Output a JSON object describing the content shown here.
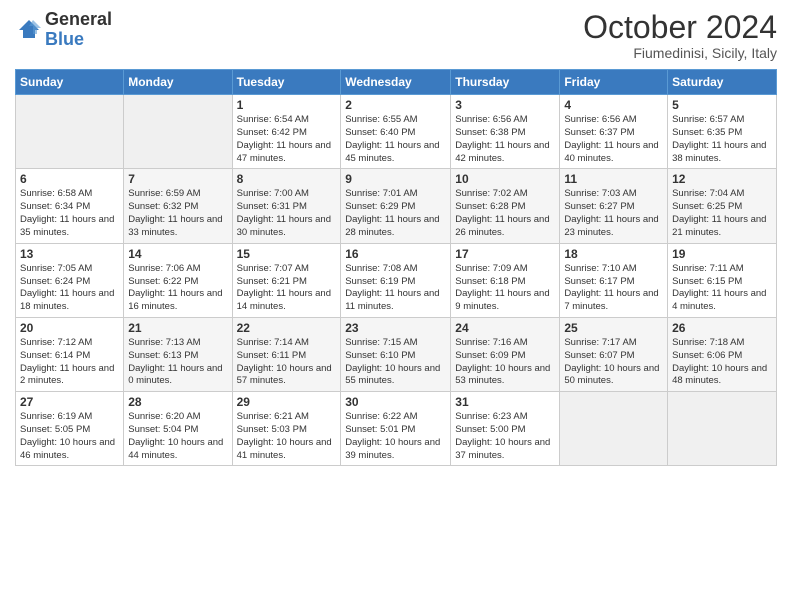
{
  "header": {
    "logo_general": "General",
    "logo_blue": "Blue",
    "month_title": "October 2024",
    "location": "Fiumedinisi, Sicily, Italy"
  },
  "days_of_week": [
    "Sunday",
    "Monday",
    "Tuesday",
    "Wednesday",
    "Thursday",
    "Friday",
    "Saturday"
  ],
  "weeks": [
    [
      {
        "day": "",
        "info": ""
      },
      {
        "day": "",
        "info": ""
      },
      {
        "day": "1",
        "info": "Sunrise: 6:54 AM\nSunset: 6:42 PM\nDaylight: 11 hours and 47 minutes."
      },
      {
        "day": "2",
        "info": "Sunrise: 6:55 AM\nSunset: 6:40 PM\nDaylight: 11 hours and 45 minutes."
      },
      {
        "day": "3",
        "info": "Sunrise: 6:56 AM\nSunset: 6:38 PM\nDaylight: 11 hours and 42 minutes."
      },
      {
        "day": "4",
        "info": "Sunrise: 6:56 AM\nSunset: 6:37 PM\nDaylight: 11 hours and 40 minutes."
      },
      {
        "day": "5",
        "info": "Sunrise: 6:57 AM\nSunset: 6:35 PM\nDaylight: 11 hours and 38 minutes."
      }
    ],
    [
      {
        "day": "6",
        "info": "Sunrise: 6:58 AM\nSunset: 6:34 PM\nDaylight: 11 hours and 35 minutes."
      },
      {
        "day": "7",
        "info": "Sunrise: 6:59 AM\nSunset: 6:32 PM\nDaylight: 11 hours and 33 minutes."
      },
      {
        "day": "8",
        "info": "Sunrise: 7:00 AM\nSunset: 6:31 PM\nDaylight: 11 hours and 30 minutes."
      },
      {
        "day": "9",
        "info": "Sunrise: 7:01 AM\nSunset: 6:29 PM\nDaylight: 11 hours and 28 minutes."
      },
      {
        "day": "10",
        "info": "Sunrise: 7:02 AM\nSunset: 6:28 PM\nDaylight: 11 hours and 26 minutes."
      },
      {
        "day": "11",
        "info": "Sunrise: 7:03 AM\nSunset: 6:27 PM\nDaylight: 11 hours and 23 minutes."
      },
      {
        "day": "12",
        "info": "Sunrise: 7:04 AM\nSunset: 6:25 PM\nDaylight: 11 hours and 21 minutes."
      }
    ],
    [
      {
        "day": "13",
        "info": "Sunrise: 7:05 AM\nSunset: 6:24 PM\nDaylight: 11 hours and 18 minutes."
      },
      {
        "day": "14",
        "info": "Sunrise: 7:06 AM\nSunset: 6:22 PM\nDaylight: 11 hours and 16 minutes."
      },
      {
        "day": "15",
        "info": "Sunrise: 7:07 AM\nSunset: 6:21 PM\nDaylight: 11 hours and 14 minutes."
      },
      {
        "day": "16",
        "info": "Sunrise: 7:08 AM\nSunset: 6:19 PM\nDaylight: 11 hours and 11 minutes."
      },
      {
        "day": "17",
        "info": "Sunrise: 7:09 AM\nSunset: 6:18 PM\nDaylight: 11 hours and 9 minutes."
      },
      {
        "day": "18",
        "info": "Sunrise: 7:10 AM\nSunset: 6:17 PM\nDaylight: 11 hours and 7 minutes."
      },
      {
        "day": "19",
        "info": "Sunrise: 7:11 AM\nSunset: 6:15 PM\nDaylight: 11 hours and 4 minutes."
      }
    ],
    [
      {
        "day": "20",
        "info": "Sunrise: 7:12 AM\nSunset: 6:14 PM\nDaylight: 11 hours and 2 minutes."
      },
      {
        "day": "21",
        "info": "Sunrise: 7:13 AM\nSunset: 6:13 PM\nDaylight: 11 hours and 0 minutes."
      },
      {
        "day": "22",
        "info": "Sunrise: 7:14 AM\nSunset: 6:11 PM\nDaylight: 10 hours and 57 minutes."
      },
      {
        "day": "23",
        "info": "Sunrise: 7:15 AM\nSunset: 6:10 PM\nDaylight: 10 hours and 55 minutes."
      },
      {
        "day": "24",
        "info": "Sunrise: 7:16 AM\nSunset: 6:09 PM\nDaylight: 10 hours and 53 minutes."
      },
      {
        "day": "25",
        "info": "Sunrise: 7:17 AM\nSunset: 6:07 PM\nDaylight: 10 hours and 50 minutes."
      },
      {
        "day": "26",
        "info": "Sunrise: 7:18 AM\nSunset: 6:06 PM\nDaylight: 10 hours and 48 minutes."
      }
    ],
    [
      {
        "day": "27",
        "info": "Sunrise: 6:19 AM\nSunset: 5:05 PM\nDaylight: 10 hours and 46 minutes."
      },
      {
        "day": "28",
        "info": "Sunrise: 6:20 AM\nSunset: 5:04 PM\nDaylight: 10 hours and 44 minutes."
      },
      {
        "day": "29",
        "info": "Sunrise: 6:21 AM\nSunset: 5:03 PM\nDaylight: 10 hours and 41 minutes."
      },
      {
        "day": "30",
        "info": "Sunrise: 6:22 AM\nSunset: 5:01 PM\nDaylight: 10 hours and 39 minutes."
      },
      {
        "day": "31",
        "info": "Sunrise: 6:23 AM\nSunset: 5:00 PM\nDaylight: 10 hours and 37 minutes."
      },
      {
        "day": "",
        "info": ""
      },
      {
        "day": "",
        "info": ""
      }
    ]
  ]
}
